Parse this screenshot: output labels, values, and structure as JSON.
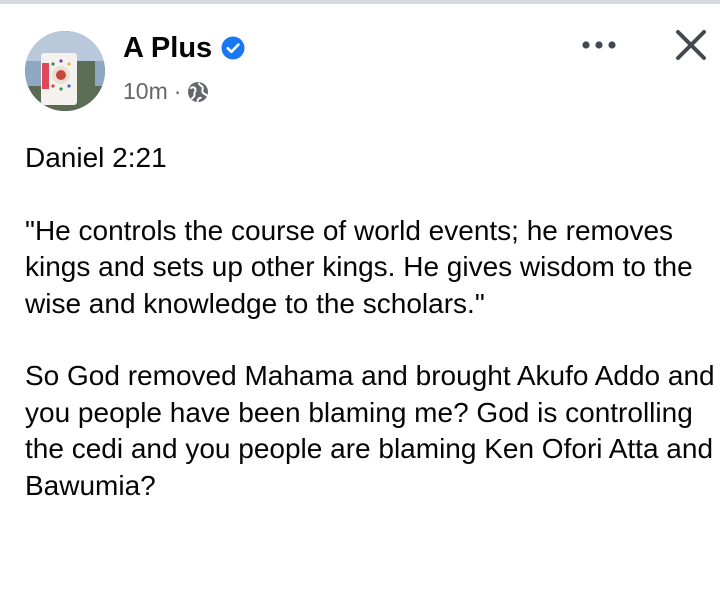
{
  "post": {
    "author": "A Plus",
    "time": "10m",
    "separator": "·",
    "privacy_icon": "globe-icon",
    "verified_icon": "verified-badge-icon",
    "more_icon": "more-options-icon",
    "close_icon": "close-icon",
    "paragraphs": [
      "Daniel 2:21",
      "\"He controls the course of world events; he removes kings and sets up other kings. He gives wisdom to the wise and knowledge to the scholars.\"",
      "So God removed Mahama and brought Akufo Addo and you people have been blaming me? God is controlling the cedi and you people are blaming Ken Ofori Atta and Bawumia?"
    ]
  },
  "colors": {
    "verified_blue": "#1877f2",
    "meta_gray": "#65676b",
    "icon_dark": "#444950"
  }
}
